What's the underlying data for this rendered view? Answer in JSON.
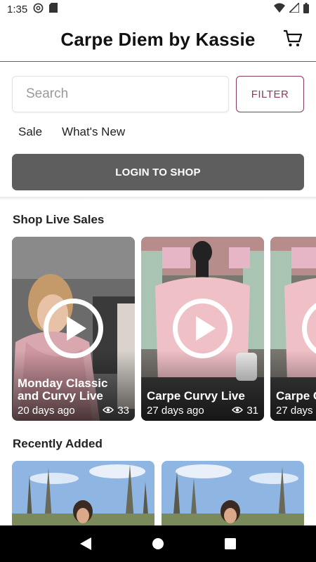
{
  "status_bar": {
    "time": "1:35",
    "icons_left": [
      "at-sign-icon",
      "sd-card-icon"
    ],
    "icons_right": [
      "wifi-icon",
      "cellular-signal-icon",
      "battery-icon"
    ]
  },
  "header": {
    "title": "Carpe Diem by Kassie",
    "cart_icon": "shopping-cart-icon"
  },
  "search": {
    "placeholder": "Search",
    "value": "",
    "filter_label": "FILTER"
  },
  "quick_links": [
    {
      "label": "Sale"
    },
    {
      "label": "What's New"
    }
  ],
  "login_button": {
    "label": "LOGIN TO SHOP"
  },
  "live_sales": {
    "title": "Shop Live Sales",
    "cards": [
      {
        "title": "Monday Classic and Curvy Live",
        "age": "20 days ago",
        "views": "33"
      },
      {
        "title": "Carpe Curvy Live",
        "age": "27 days ago",
        "views": "31"
      },
      {
        "title": "Carpe C",
        "age": "27 days",
        "views": ""
      }
    ]
  },
  "recently_added": {
    "title": "Recently Added"
  },
  "colors": {
    "accent": "#8a3a5e",
    "login_bg": "#5e5e5e",
    "nav_bar": "#000000"
  }
}
